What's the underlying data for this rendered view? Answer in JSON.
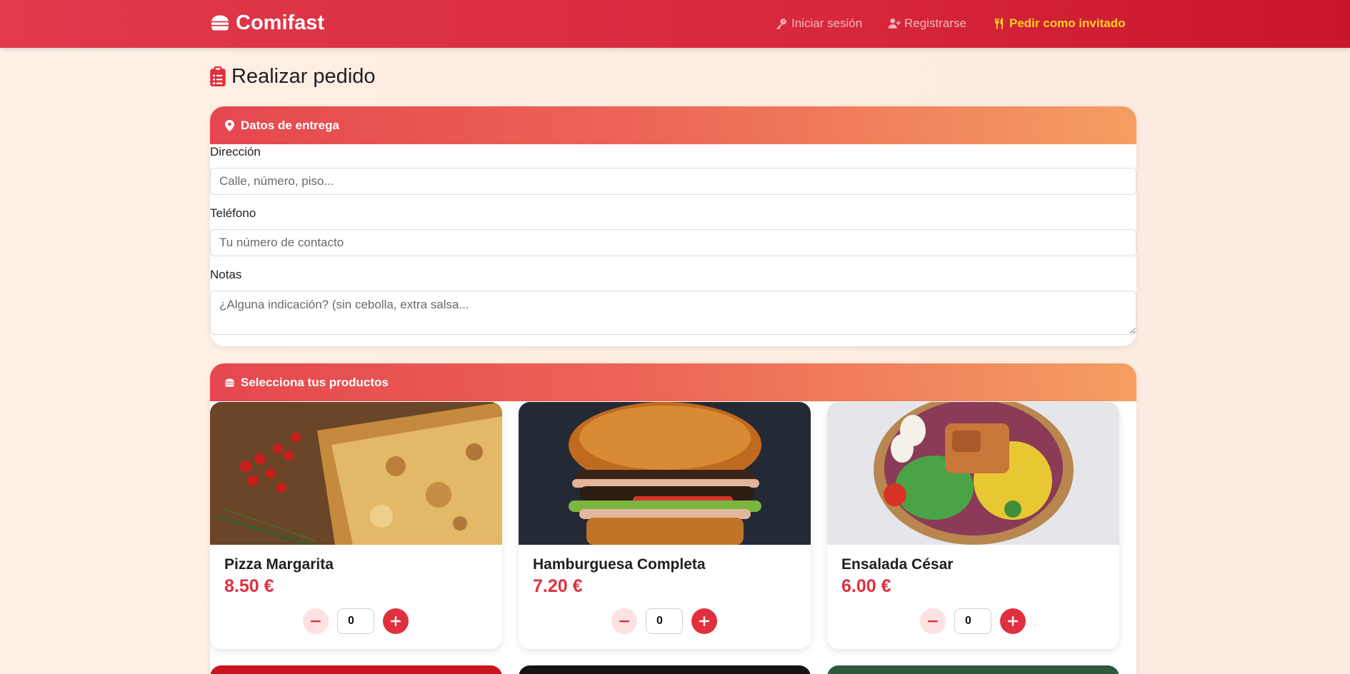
{
  "navbar": {
    "brand": "Comifast",
    "login": "Iniciar sesión",
    "register": "Registrarse",
    "guest": "Pedir como invitado"
  },
  "page": {
    "title": "Realizar pedido"
  },
  "delivery": {
    "header": "Datos de entrega",
    "address_label": "Dirección",
    "address_placeholder": "Calle, número, piso...",
    "phone_label": "Teléfono",
    "phone_placeholder": "Tu número de contacto",
    "notes_label": "Notas",
    "notes_placeholder": "¿Alguna indicación? (sin cebolla, extra salsa..."
  },
  "products": {
    "header": "Selecciona tus productos",
    "items": [
      {
        "name": "Pizza Margarita",
        "price": "8.50 €",
        "qty": "0"
      },
      {
        "name": "Hamburguesa Completa",
        "price": "7.20 €",
        "qty": "0"
      },
      {
        "name": "Ensalada César",
        "price": "6.00 €",
        "qty": "0"
      }
    ]
  },
  "colors": {
    "brand_red": "#e0303f",
    "guest_yellow": "#ffd21f",
    "header_gradient_start": "#e5474f",
    "header_gradient_end": "#f49e62"
  },
  "icons": {
    "brand": "burger-icon",
    "login": "key-icon",
    "register": "user-plus-icon",
    "guest": "utensils-icon",
    "title": "clipboard-list-icon",
    "delivery": "map-pin-icon",
    "products": "burger-icon"
  }
}
